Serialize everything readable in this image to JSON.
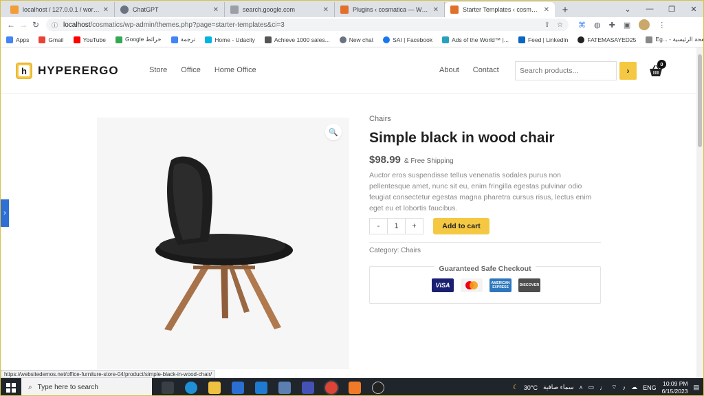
{
  "browser": {
    "tabs": [
      {
        "title": "localhost / 127.0.0.1 / wordpress",
        "color": "#f29d38"
      },
      {
        "title": "ChatGPT",
        "color": "#6b7280"
      },
      {
        "title": "search.google.com",
        "color": "#9aa0a6"
      },
      {
        "title": "Plugins ‹ cosmatica — WordPress",
        "color": "#e0702a"
      },
      {
        "title": "Starter Templates ‹ cosmatica —",
        "color": "#e0702a"
      }
    ],
    "url_host": "localhost",
    "url_path": "/cosmatics/wp-admin/themes.php?page=starter-templates&ci=3",
    "bookmarks": [
      {
        "label": "Apps",
        "color": "#4285f4"
      },
      {
        "label": "Gmail",
        "color": "#ea4335"
      },
      {
        "label": "YouTube",
        "color": "#ff0000"
      },
      {
        "label": "Google خرائط",
        "color": "#34a853"
      },
      {
        "label": "ترجمة",
        "color": "#4285f4"
      },
      {
        "label": "Home - Udacity",
        "color": "#02b3e4"
      },
      {
        "label": "Achieve 1000 sales...",
        "color": "#555555"
      },
      {
        "label": "New chat",
        "color": "#6b7280"
      },
      {
        "label": "SAI | Facebook",
        "color": "#1877f2"
      },
      {
        "label": "Ads of the World™ |...",
        "color": "#2aa0c0"
      },
      {
        "label": "Feed | LinkedIn",
        "color": "#0a66c2"
      },
      {
        "label": "FATEMASAYED25",
        "color": "#222222"
      },
      {
        "label": "Eg... - الصفحة الرئيسية",
        "color": "#888888"
      }
    ],
    "status_url": "https://websitedemos.net/office-furniture-store-04/product/simple-black-in-wood-chair/"
  },
  "site": {
    "brand": "HYPERERGO",
    "logo_letter": "h",
    "nav_left": [
      "Store",
      "Office",
      "Home Office"
    ],
    "nav_right": [
      "About",
      "Contact"
    ],
    "search_placeholder": "Search products...",
    "cart_count": "0",
    "accent": "#f5c843"
  },
  "product": {
    "category_top": "Chairs",
    "title": "Simple black in wood chair",
    "price": "$98.99",
    "shipping": "& Free Shipping",
    "description": "Auctor eros suspendisse tellus venenatis sodales purus non pellentesque amet, nunc sit eu, enim fringilla egestas pulvinar odio feugiat consectetur egestas magna pharetra cursus risus, lectus enim eget eu et lobortis faucibus.",
    "qty_minus": "-",
    "qty_value": "1",
    "qty_plus": "+",
    "add_to_cart": "Add to cart",
    "category_label": "Category:",
    "category_value": "Chairs",
    "checkout_title": "Guaranteed Safe Checkout",
    "cards": [
      {
        "name": "VISA",
        "bg": "#1a1f71",
        "fg": "#ffffff"
      },
      {
        "name": "",
        "bg": "#f3f3f3",
        "fg": "#000000"
      },
      {
        "name": "AMERICAN EXPRESS",
        "bg": "#2e77bc",
        "fg": "#ffffff"
      },
      {
        "name": "DISCOVER",
        "bg": "#4d4d4d",
        "fg": "#ffffff"
      }
    ]
  },
  "taskbar": {
    "search_placeholder": "Type here to search",
    "temperature": "30°C",
    "weather": "سماء صافية",
    "lang": "ENG",
    "time": "10:09 PM",
    "date": "6/15/2023"
  }
}
